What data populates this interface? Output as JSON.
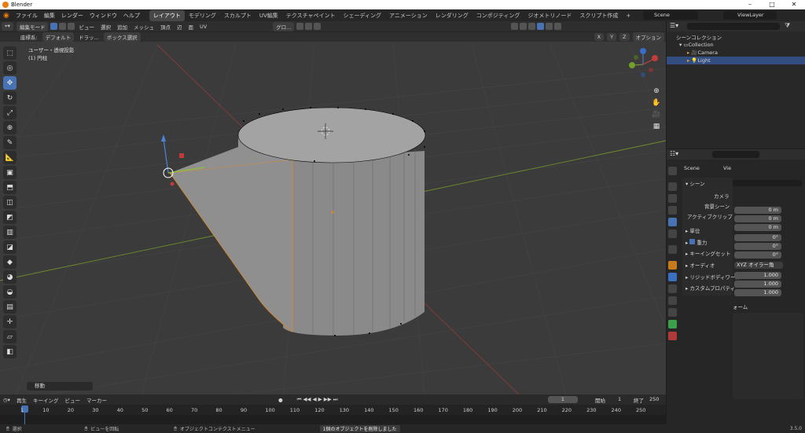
{
  "window": {
    "title": "Blender"
  },
  "menu": [
    "ファイル",
    "編集",
    "レンダー",
    "ウィンドウ",
    "ヘルプ"
  ],
  "workspaces": [
    {
      "label": "レイアウト",
      "active": true
    },
    {
      "label": "モデリング"
    },
    {
      "label": "スカルプト"
    },
    {
      "label": "UV編集"
    },
    {
      "label": "テクスチャペイント"
    },
    {
      "label": "シェーディング"
    },
    {
      "label": "アニメーション"
    },
    {
      "label": "レンダリング"
    },
    {
      "label": "コンポジティング"
    },
    {
      "label": "ジオメトリノード"
    },
    {
      "label": "スクリプト作成"
    }
  ],
  "top_right": {
    "scene": "Scene",
    "view_layer": "ViewLayer",
    "add_tab": "+"
  },
  "viewport_header": {
    "mode": "編集モード",
    "menus": [
      "ビュー",
      "選択",
      "追加",
      "メッシュ",
      "頂点",
      "辺",
      "面",
      "UV"
    ],
    "transform": "グロ...",
    "options": "オプション"
  },
  "viewport_header2": {
    "coord_label": "座標系:",
    "coord": "デフォルト",
    "drag_label": "ドラッ...",
    "select_box": "ボックス選択",
    "axes": [
      "X",
      "Y",
      "Z"
    ]
  },
  "viewport": {
    "view_name": "ユーザー・透視投影",
    "object_name": "(1) 円柱",
    "last_op": "移動"
  },
  "gizmo": {
    "x": "X",
    "y": "Y",
    "z": "Z"
  },
  "timeline": {
    "menus": [
      "再生",
      "キーイング",
      "ビュー",
      "マーカー"
    ],
    "current_frame": "1",
    "start_label": "開始",
    "start": "1",
    "end_label": "終了",
    "end": "250",
    "ticks": [
      "1",
      "10",
      "20",
      "30",
      "40",
      "50",
      "60",
      "70",
      "80",
      "90",
      "100",
      "110",
      "120",
      "130",
      "140",
      "150",
      "160",
      "170",
      "180",
      "190",
      "200",
      "210",
      "220",
      "230",
      "240",
      "250"
    ]
  },
  "status": {
    "select": "選択",
    "rotate": "ビューを回転",
    "context": "オブジェクトコンテクストメニュー",
    "message": "1個のオブジェクトを削除しました",
    "version": "3.5.0"
  },
  "outliner": {
    "root": "シーンコレクション",
    "collection": "Collection",
    "items": [
      "Camera",
      "Light"
    ]
  },
  "properties": {
    "breadcrumb": [
      "Scene",
      "Vie"
    ],
    "section": "シーン",
    "rows": [
      {
        "label": "カメラ",
        "value": ""
      },
      {
        "label": "背景シーン",
        "value": ""
      },
      {
        "label": "アクティブクリップ",
        "value": ""
      }
    ],
    "unit": "単位",
    "gravity": "重力",
    "keying": "キーイングセット",
    "audio": "オーディオ",
    "rigid": "リジッドボディワール",
    "custom": "カスタムプロパティ",
    "values": [
      "0 m",
      "0 m",
      "0 m",
      "0°",
      "0°",
      "0°"
    ],
    "rotation_mode": "XYZ オイラー角",
    "scale": [
      "1.000",
      "1.000",
      "1.000"
    ],
    "transform_partial": "ォーム"
  }
}
